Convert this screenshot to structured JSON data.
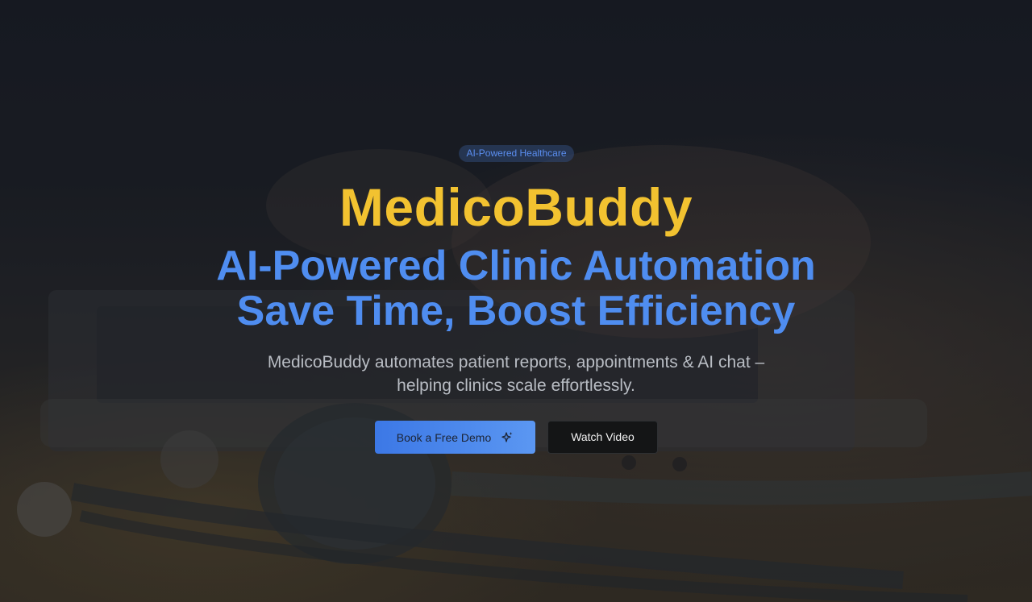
{
  "hero": {
    "badge": "AI-Powered Healthcare",
    "brand": "MedicoBuddy",
    "headline_line1": "AI-Powered Clinic Automation",
    "headline_line2": "Save Time, Boost Efficiency",
    "subtitle_line1": "MedicoBuddy automates patient reports, appointments & AI chat –",
    "subtitle_line2": "helping clinics scale effortlessly."
  },
  "actions": {
    "primary_label": "Book a Free Demo",
    "primary_icon": "sparkle-icon",
    "secondary_label": "Watch Video"
  },
  "colors": {
    "brand": "#f2c230",
    "headline": "#4f8df0",
    "primary_button": "#4a86ee",
    "secondary_button": "#141516"
  }
}
